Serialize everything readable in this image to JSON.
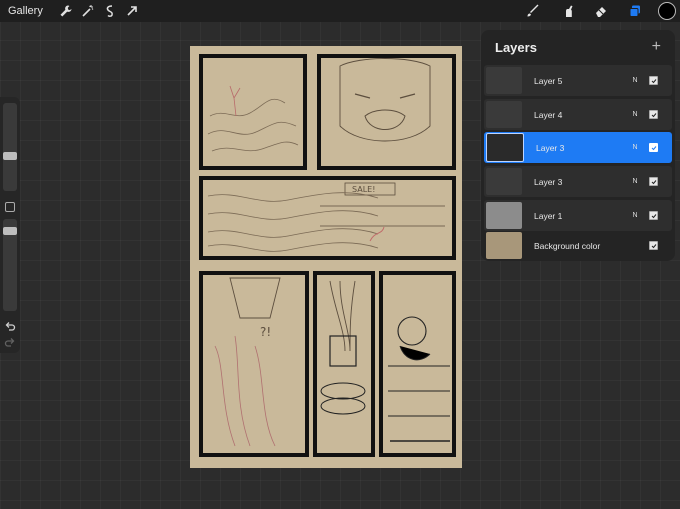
{
  "topbar": {
    "gallery_label": "Gallery",
    "left_tools": [
      "wrench-icon",
      "magic-wand-icon",
      "selection-icon",
      "transform-arrow-icon"
    ],
    "right_tools": [
      "brush-icon",
      "smudge-icon",
      "eraser-icon",
      "layers-icon"
    ],
    "current_color": "#000000",
    "accent_color": "#1e7bf4"
  },
  "sidebar": {
    "brush_size_level": 0.3,
    "opacity_level": 0.38
  },
  "layers": {
    "title": "Layers",
    "add_label": "+",
    "items": [
      {
        "name": "Layer 5",
        "blend": "N",
        "visible": true,
        "active": false
      },
      {
        "name": "Layer 4",
        "blend": "N",
        "visible": true,
        "active": false
      },
      {
        "name": "Layer 3",
        "blend": "N",
        "visible": true,
        "active": true
      },
      {
        "name": "Layer 3",
        "blend": "N",
        "visible": true,
        "active": false
      },
      {
        "name": "Layer 1",
        "blend": "N",
        "visible": true,
        "active": false
      },
      {
        "name": "Background color",
        "blend": "",
        "visible": true,
        "active": false
      }
    ]
  },
  "canvas": {
    "paper_color": "#c9b99a",
    "panel_text_1": "SALE!",
    "panel_text_2": "?!"
  }
}
